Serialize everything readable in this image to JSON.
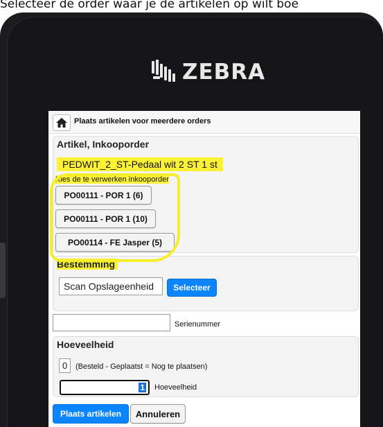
{
  "caption": "Selecteer de order waar je de artikelen op wilt boe",
  "logo": {
    "text": "ZEBRA",
    "icon": "zebra-head-icon"
  },
  "header": {
    "title": "Plaats artikelen voor meerdere orders",
    "home_icon": "home-icon"
  },
  "article_panel": {
    "title": "Artikel, Inkooporder",
    "item": "PEDWIT_2_ST-Pedaal wit 2 ST 1 st",
    "hint": "Kies de te verwerken inkooporder",
    "orders": [
      "PO00111 - POR 1 (6)",
      "PO00111 - POR 1 (10)",
      "PO00114 - FE Jasper (5)"
    ]
  },
  "destination_panel": {
    "title": "Bestemming",
    "input_value": "Scan Opslageenheid",
    "select_label": "Selecteer"
  },
  "serial": {
    "value": "",
    "label": "Serienummer"
  },
  "quantity_panel": {
    "title": "Hoeveelheid",
    "ordered_value": "0",
    "ordered_note": "(Besteld - Geplaatst = Nog te plaatsen)",
    "input_value": "1",
    "input_label": "Hoeveelheid"
  },
  "actions": {
    "place_label": "Plaats artikelen",
    "cancel_label": "Annuleren"
  },
  "colors": {
    "highlight": "#fbf236",
    "primary": "#0a84ff"
  }
}
